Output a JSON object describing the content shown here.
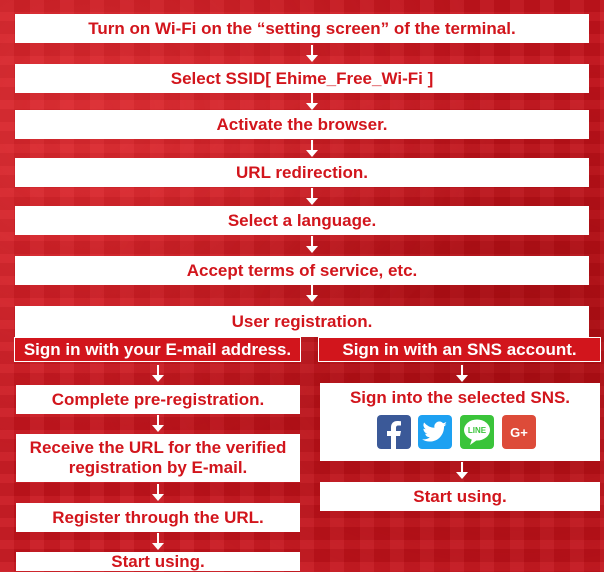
{
  "steps": {
    "s1": "Turn on Wi-Fi on the “setting screen” of the terminal.",
    "s2": "Select SSID[ Ehime_Free_Wi-Fi ]",
    "s3": "Activate the browser.",
    "s4": "URL redirection.",
    "s5": "Select a language.",
    "s6": "Accept terms of service, etc.",
    "s7": "User registration."
  },
  "left": {
    "header": "Sign in with your E-mail address.",
    "step1": "Complete pre-registration.",
    "step2_line1": "Receive the URL for the verified",
    "step2_line2": "registration by E-mail.",
    "step3": "Register through the URL.",
    "step4": "Start using."
  },
  "right": {
    "header": "Sign in with an SNS account.",
    "step1": "Sign into the selected SNS.",
    "sns_icons": [
      "facebook-icon",
      "twitter-icon",
      "line-icon",
      "google-plus-icon"
    ],
    "line_icon_text": "LINE",
    "gplus_text": "G+",
    "step2": "Start using."
  },
  "colors": {
    "accent": "#d2151c",
    "facebook": "#3b5998",
    "twitter": "#1da1f2",
    "line": "#3ac43a",
    "googleplus": "#dd4b39"
  }
}
